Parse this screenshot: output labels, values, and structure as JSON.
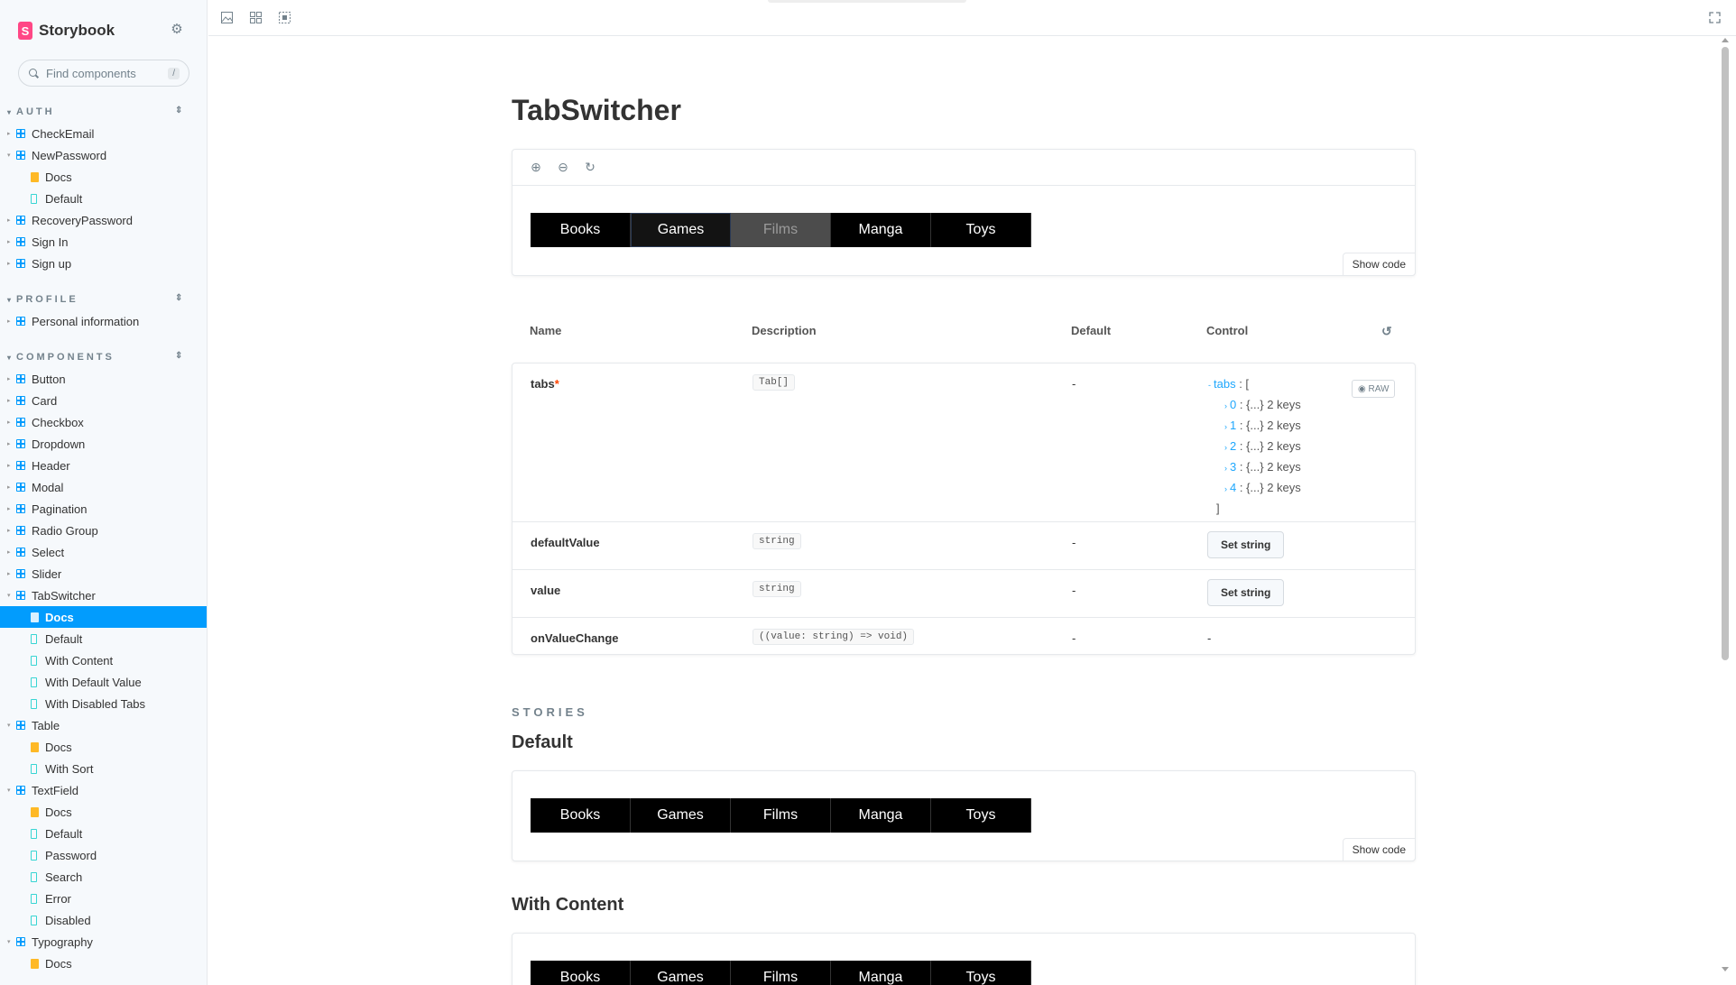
{
  "sidebar": {
    "brand": "Storybook",
    "search": {
      "placeholder": "Find components",
      "shortcut": "/"
    },
    "groups": {
      "auth": "AUTH",
      "profile": "PROFILE",
      "components": "COMPONENTS"
    },
    "auth_items": [
      "CheckEmail",
      "NewPassword",
      "Docs",
      "Default",
      "RecoveryPassword",
      "Sign In",
      "Sign up"
    ],
    "profile_items": [
      "Personal information"
    ],
    "component_items": [
      "Button",
      "Card",
      "Checkbox",
      "Dropdown",
      "Header",
      "Modal",
      "Pagination",
      "Radio Group",
      "Select",
      "Slider",
      "TabSwitcher"
    ],
    "tabswitcher_stories": [
      "Docs",
      "Default",
      "With Content",
      "With Default Value",
      "With Disabled Tabs"
    ],
    "table": {
      "label": "Table",
      "stories": [
        "Docs",
        "With Sort"
      ]
    },
    "textfield": {
      "label": "TextField",
      "stories": [
        "Docs",
        "Default",
        "Password",
        "Search",
        "Error",
        "Disabled"
      ]
    },
    "typography": {
      "label": "Typography",
      "stories": [
        "Docs"
      ]
    }
  },
  "doc": {
    "title": "TabSwitcher",
    "tabs": [
      "Books",
      "Games",
      "Films",
      "Manga",
      "Toys"
    ],
    "show_code": "Show code"
  },
  "args": {
    "headers": {
      "name": "Name",
      "description": "Description",
      "default": "Default",
      "control": "Control"
    },
    "rows": [
      {
        "name": "tabs",
        "required": "*",
        "type": "Tab[]",
        "default": "-"
      },
      {
        "name": "defaultValue",
        "type": "string",
        "default": "-",
        "control": "Set string"
      },
      {
        "name": "value",
        "type": "string",
        "default": "-",
        "control": "Set string"
      },
      {
        "name": "onValueChange",
        "type": "((value: string) => void)",
        "default": "-",
        "control": "-"
      }
    ],
    "tabs_control": {
      "root_key": "tabs",
      "open": ": [",
      "close": "]",
      "entries": [
        {
          "key": "0",
          "value": ": {...} 2 keys"
        },
        {
          "key": "1",
          "value": ": {...} 2 keys"
        },
        {
          "key": "2",
          "value": ": {...} 2 keys"
        },
        {
          "key": "3",
          "value": ": {...} 2 keys"
        },
        {
          "key": "4",
          "value": ": {...} 2 keys"
        }
      ],
      "raw_label": "RAW"
    }
  },
  "stories": {
    "label": "STORIES",
    "default_title": "Default",
    "with_content_title": "With Content"
  },
  "colors": {
    "accent": "#029cfd",
    "tab_bg": "#000000",
    "brand": "#ff4785"
  }
}
